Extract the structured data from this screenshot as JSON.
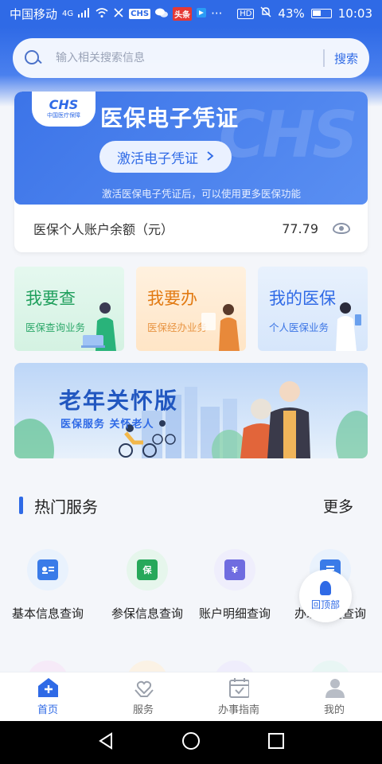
{
  "status_bar": {
    "carrier": "中国移动",
    "network": "4G",
    "battery": "43%",
    "time": "10:03",
    "hd": "HD",
    "toutiao": "头条",
    "more": "···"
  },
  "search": {
    "placeholder": "输入相关搜索信息",
    "button_label": "搜索"
  },
  "cert_card": {
    "logo_text": "CHS",
    "logo_sub": "中国医疗保障",
    "title": "医保电子凭证",
    "watermark": "CHS",
    "activate_label": "激活电子凭证",
    "tip": "激活医保电子凭证后，可以使用更多医保功能",
    "balance_label": "医保个人账户余额（元）",
    "balance_value": "77.79"
  },
  "quick_entries": [
    {
      "title": "我要查",
      "sub": "医保查询业务"
    },
    {
      "title": "我要办",
      "sub": "医保经办业务"
    },
    {
      "title": "我的医保",
      "sub": "个人医保业务"
    }
  ],
  "elder_banner": {
    "title": "老年关怀版",
    "sub": "医保服务 关怀老人"
  },
  "hot_services": {
    "title": "热门服务",
    "more_label": "更多",
    "items": [
      {
        "label": "基本信息查询",
        "icon": "id-card-icon",
        "color": "#3a7be8",
        "bg": "#e9f2fd"
      },
      {
        "label": "参保信息查询",
        "icon": "insurance-doc-icon",
        "color": "#27a85a",
        "bg": "#e6f6ec"
      },
      {
        "label": "账户明细查询",
        "icon": "account-detail-icon",
        "color": "#6f6ce0",
        "bg": "#efeefc"
      },
      {
        "label": "办理进度查询",
        "icon": "progress-doc-icon",
        "color": "#3a7be8",
        "bg": "#e9f2fd"
      }
    ],
    "insurance_glyph": "保",
    "account_glyph": "¥"
  },
  "back_to_top": "回顶部",
  "tabs": [
    {
      "label": "首页",
      "active": true
    },
    {
      "label": "服务",
      "active": false
    },
    {
      "label": "办事指南",
      "active": false
    },
    {
      "label": "我的",
      "active": false
    }
  ],
  "colors": {
    "primary": "#2f6ae6",
    "green": "#1f9f5c",
    "orange": "#e27a12"
  }
}
